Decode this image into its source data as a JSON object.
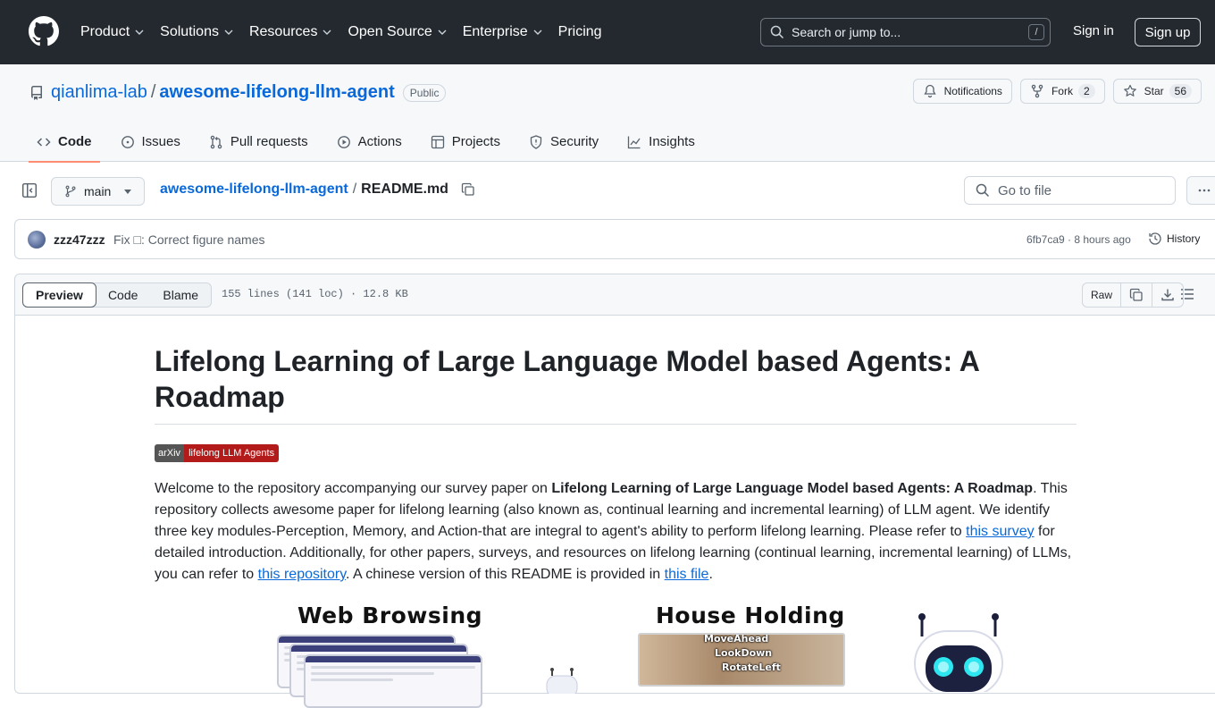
{
  "header": {
    "nav": [
      "Product",
      "Solutions",
      "Resources",
      "Open Source",
      "Enterprise",
      "Pricing"
    ],
    "nav_has_dropdown": [
      true,
      true,
      true,
      true,
      true,
      false
    ],
    "search_placeholder": "Search or jump to...",
    "search_shortcut": "/",
    "sign_in": "Sign in",
    "sign_up": "Sign up"
  },
  "repo": {
    "owner": "qianlima-lab",
    "separator": "/",
    "name": "awesome-lifelong-llm-agent",
    "visibility": "Public",
    "notifications_label": "Notifications",
    "fork_label": "Fork",
    "fork_count": "2",
    "star_label": "Star",
    "star_count": "56",
    "tabs": [
      {
        "label": "Code",
        "icon": "code-icon",
        "active": true
      },
      {
        "label": "Issues",
        "icon": "issue-icon",
        "active": false
      },
      {
        "label": "Pull requests",
        "icon": "pull-request-icon",
        "active": false
      },
      {
        "label": "Actions",
        "icon": "play-icon",
        "active": false
      },
      {
        "label": "Projects",
        "icon": "table-icon",
        "active": false
      },
      {
        "label": "Security",
        "icon": "shield-icon",
        "active": false
      },
      {
        "label": "Insights",
        "icon": "graph-icon",
        "active": false
      }
    ]
  },
  "file_nav": {
    "branch": "main",
    "breadcrumb_repo": "awesome-lifelong-llm-agent",
    "breadcrumb_sep": "/",
    "breadcrumb_file": "README.md",
    "goto_placeholder": "Go to file"
  },
  "commit": {
    "author": "zzz47zzz",
    "message": "Fix □: Correct figure names",
    "sha": "6fb7ca9",
    "time": "8 hours ago",
    "meta": "6fb7ca9 · 8 hours ago",
    "history_label": "History"
  },
  "file_view": {
    "modes": [
      "Preview",
      "Code",
      "Blame"
    ],
    "active_mode": "Preview",
    "info": "155 lines (141 loc) · 12.8 KB",
    "raw_label": "Raw"
  },
  "readme": {
    "title": "Lifelong Learning of Large Language Model based Agents: A Roadmap",
    "badge_left": "arXiv",
    "badge_right": "lifelong LLM Agents",
    "badge_color": "#b31b1b",
    "intro_1": "Welcome to the repository accompanying our survey paper on ",
    "intro_bold": "Lifelong Learning of Large Language Model based Agents: A Roadmap",
    "intro_2": ". This repository collects awesome paper for lifelong learning (also known as, continual learning and incremental learning) of LLM agent. We identify three key modules-Perception, Memory, and Action-that are integral to agent's ability to perform lifelong learning. Please refer to ",
    "link_survey": "this survey",
    "intro_3": " for detailed introduction. Additionally, for other papers, surveys, and resources on lifelong learning (continual learning, incremental learning) of LLMs, you can refer to ",
    "link_repo": "this repository",
    "intro_4": ". A chinese version of this README is provided in ",
    "link_file": "this file",
    "intro_5": "."
  },
  "figure": {
    "title_web": "Web Browsing",
    "title_house": "House Holding",
    "house_commands": [
      "MoveAhead",
      "LookDown",
      "RotateLeft"
    ]
  }
}
